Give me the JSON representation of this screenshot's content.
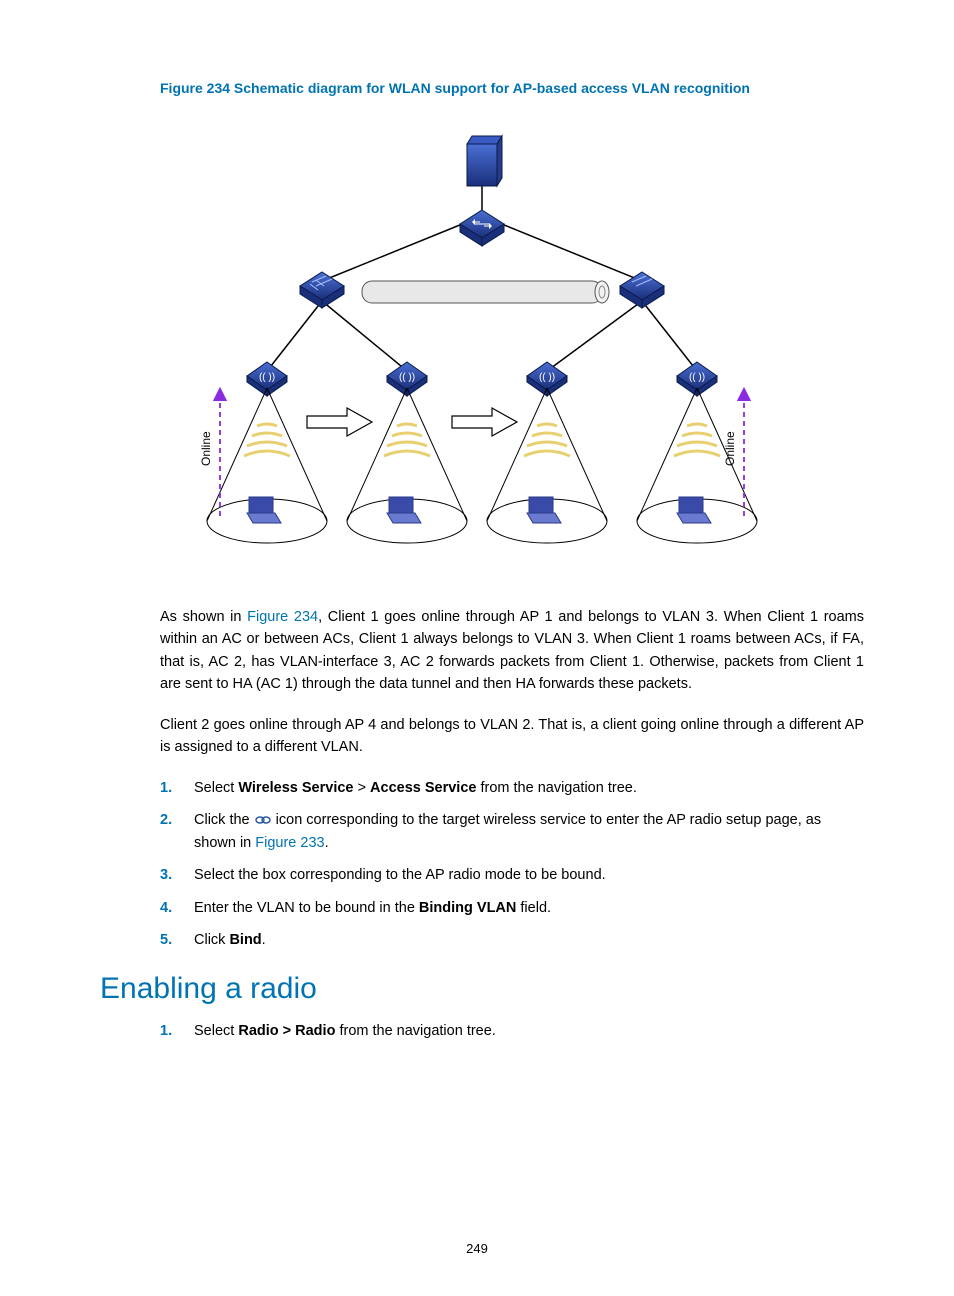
{
  "figure": {
    "caption": "Figure 234 Schematic diagram for WLAN support for AP-based access VLAN recognition",
    "online_label_left": "Online",
    "online_label_right": "Online"
  },
  "para1_prefix": "As shown in ",
  "para1_link": "Figure 234",
  "para1_rest": ", Client 1 goes online through AP 1 and belongs to VLAN 3. When Client 1 roams within an AC or between ACs, Client 1 always belongs to VLAN 3. When Client 1 roams between ACs, if FA, that is, AC 2, has VLAN-interface 3, AC 2 forwards packets from Client 1. Otherwise, packets from Client 1 are sent to HA (AC 1) through the data tunnel and then HA forwards these packets.",
  "para2": "Client 2 goes online through AP 4 and belongs to VLAN 2. That is, a client going online through a different AP is assigned to a different VLAN.",
  "steps": [
    {
      "num": "1.",
      "pre": "Select ",
      "b1": "Wireless Service",
      "mid": " > ",
      "b2": "Access Service",
      "post": " from the navigation tree."
    },
    {
      "num": "2.",
      "pre": "Click the ",
      "icon": true,
      "mid": " icon corresponding to the target wireless service to enter the AP radio setup page, as shown in ",
      "link": "Figure 233",
      "post": "."
    },
    {
      "num": "3.",
      "text": "Select the box corresponding to the AP radio mode to be bound."
    },
    {
      "num": "4.",
      "pre": "Enter the VLAN to be bound in the ",
      "b1": "Binding VLAN",
      "post": " field."
    },
    {
      "num": "5.",
      "pre": "Click ",
      "b1": "Bind",
      "post": "."
    }
  ],
  "heading": "Enabling a radio",
  "steps2": [
    {
      "num": "1.",
      "pre": "Select ",
      "b1": "Radio > Radio",
      "post": " from the navigation tree."
    }
  ],
  "page_number": "249"
}
